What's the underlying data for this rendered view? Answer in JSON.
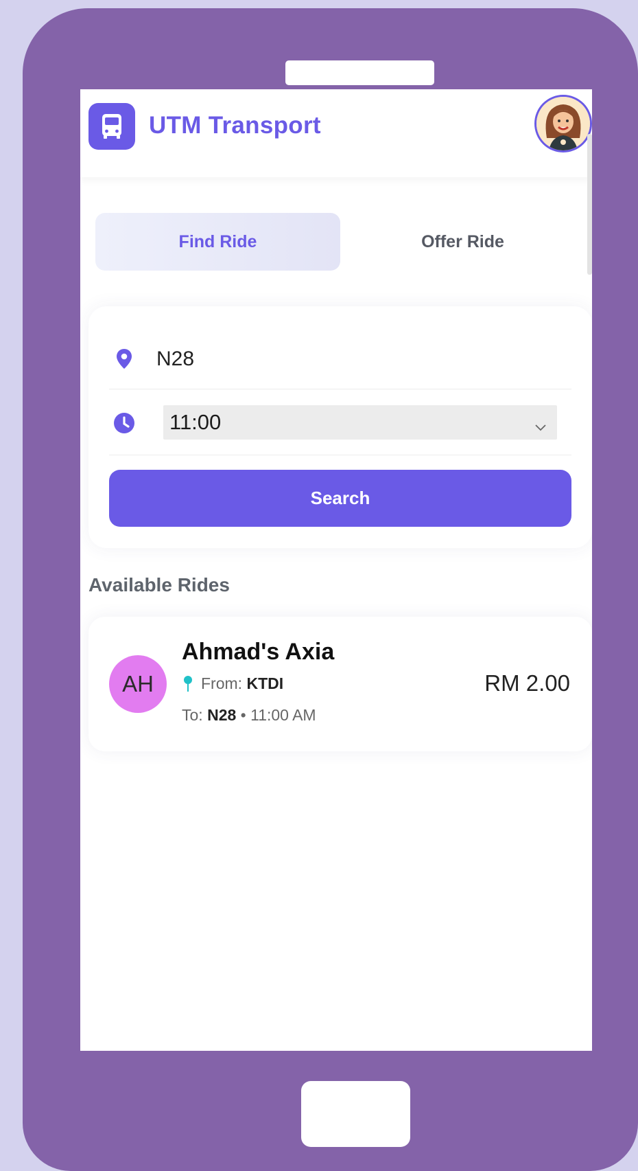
{
  "header": {
    "title": "UTM Transport"
  },
  "tabs": [
    {
      "label": "Find Ride",
      "active": true
    },
    {
      "label": "Offer Ride",
      "active": false
    }
  ],
  "search_form": {
    "location": "N28",
    "time": "11:00",
    "search_label": "Search"
  },
  "available_rides": {
    "title": "Available Rides",
    "rides": [
      {
        "initials": "AH",
        "name": "Ahmad's Axia",
        "from_label": "From:",
        "from": "KTDI",
        "to_label": "To:",
        "to": "N28",
        "time": "• 11:00 AM",
        "price": "RM 2.00"
      }
    ]
  },
  "colors": {
    "accent": "#6a5ae6",
    "phone_frame": "#8463a9",
    "background": "#d4d2ee",
    "driver_avatar": "#e27cf0",
    "pin": "#20c1c8"
  },
  "icons": {
    "logo": "bus-icon",
    "location": "map-pin-icon",
    "time": "clock-icon",
    "select": "chevron-down-icon",
    "ride_from": "pushpin-icon"
  }
}
